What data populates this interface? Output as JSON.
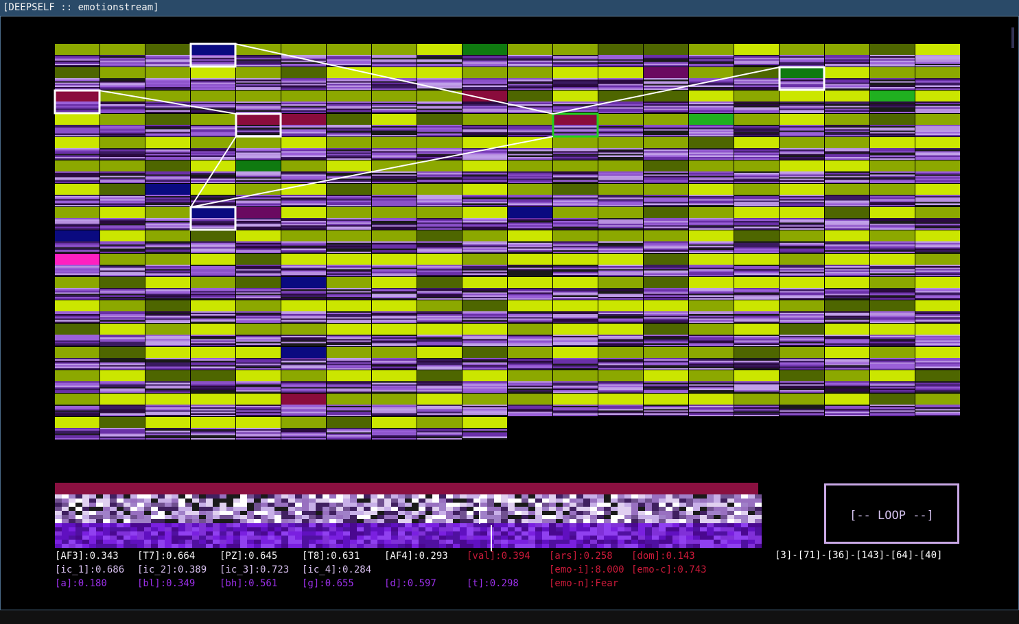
{
  "window": {
    "title": "[DEEPSELF :: emotionstream]"
  },
  "grid": {
    "cols": 20,
    "rows": 17,
    "last_row_cells": 10,
    "palette": {
      "lime": "#cbe600",
      "olive": "#8ca800",
      "dark_olive": "#4e6600",
      "green": "#0f7a10",
      "bright_green": "#20b020",
      "maroon": "#8a0c3c",
      "plum": "#6a0a60",
      "navy": "#0a0a80",
      "magenta": "#ff20c0",
      "texture": "#6a30a8"
    },
    "special_cells": [
      {
        "row": 0,
        "col": 3,
        "color": "navy",
        "selected": true
      },
      {
        "row": 0,
        "col": 9,
        "color": "green"
      },
      {
        "row": 0,
        "col": 12,
        "color": "dark_olive"
      },
      {
        "row": 0,
        "col": 13,
        "color": "dark_olive"
      },
      {
        "row": 1,
        "col": 13,
        "color": "plum"
      },
      {
        "row": 1,
        "col": 16,
        "color": "green",
        "selected": true
      },
      {
        "row": 2,
        "col": 0,
        "color": "maroon",
        "selected": true
      },
      {
        "row": 2,
        "col": 9,
        "color": "maroon"
      },
      {
        "row": 2,
        "col": 18,
        "color": "bright_green"
      },
      {
        "row": 3,
        "col": 4,
        "color": "maroon",
        "selected": true
      },
      {
        "row": 3,
        "col": 5,
        "color": "maroon"
      },
      {
        "row": 3,
        "col": 11,
        "color": "maroon",
        "current": true
      },
      {
        "row": 3,
        "col": 14,
        "color": "bright_green"
      },
      {
        "row": 5,
        "col": 4,
        "color": "green"
      },
      {
        "row": 6,
        "col": 2,
        "color": "navy"
      },
      {
        "row": 7,
        "col": 3,
        "color": "navy",
        "selected": true
      },
      {
        "row": 7,
        "col": 4,
        "color": "plum"
      },
      {
        "row": 7,
        "col": 10,
        "color": "navy"
      },
      {
        "row": 8,
        "col": 0,
        "color": "navy"
      },
      {
        "row": 9,
        "col": 0,
        "color": "magenta"
      },
      {
        "row": 10,
        "col": 5,
        "color": "navy"
      },
      {
        "row": 13,
        "col": 5,
        "color": "navy"
      },
      {
        "row": 15,
        "col": 5,
        "color": "maroon"
      }
    ]
  },
  "spectrogram": {
    "bar_color": "#8a1040"
  },
  "metrics": [
    {
      "label": "[AF3]:0.343",
      "color": "white"
    },
    {
      "label": "[T7]:0.664",
      "color": "white"
    },
    {
      "label": "[PZ]:0.645",
      "color": "white"
    },
    {
      "label": "[T8]:0.631",
      "color": "white"
    },
    {
      "label": "[AF4]:0.293",
      "color": "white"
    },
    {
      "label": "[val]:0.394",
      "color": "red"
    },
    {
      "label": "[ars]:0.258",
      "color": "red"
    },
    {
      "label": "[dom]:0.143",
      "color": "red"
    },
    {
      "label": "[ic_1]:0.686",
      "color": "lavender"
    },
    {
      "label": "[ic_2]:0.389",
      "color": "lavender"
    },
    {
      "label": "[ic_3]:0.723",
      "color": "lavender"
    },
    {
      "label": "[ic_4]:0.284",
      "color": "lavender"
    },
    {
      "label": "[emo-i]:8.000",
      "color": "red"
    },
    {
      "label": "[emo-c]:0.743",
      "color": "red"
    },
    {
      "label": "[a]:0.180",
      "color": "violet"
    },
    {
      "label": "[bl]:0.349",
      "color": "violet"
    },
    {
      "label": "[bh]:0.561",
      "color": "violet"
    },
    {
      "label": "[g]:0.655",
      "color": "violet"
    },
    {
      "label": "[d]:0.597",
      "color": "violet"
    },
    {
      "label": "[t]:0.298",
      "color": "violet"
    },
    {
      "label": "[emo-n]:Fear",
      "color": "red"
    }
  ],
  "loop": {
    "label": "[-- LOOP --]"
  },
  "chain": "[3]-[71]-[36]-[143]-[64]-[40]"
}
